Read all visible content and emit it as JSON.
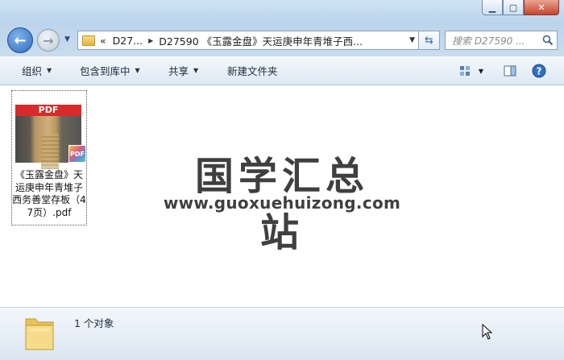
{
  "window": {
    "minimize_icon": "minimize-icon",
    "maximize_icon": "maximize-icon",
    "close_icon": "close-icon"
  },
  "address_bar": {
    "overflow": "«",
    "crumbs": [
      "D27...",
      "D27590 《玉露金盘》天运庚申年青堆子西..."
    ]
  },
  "search": {
    "placeholder": "搜索 D27590 ..."
  },
  "toolbar": {
    "organize": "组织",
    "include_library": "包含到库中",
    "share": "共享",
    "new_folder": "新建文件夹"
  },
  "file": {
    "thumb_label": "PDF",
    "badge_label": "PDF",
    "name": "《玉露金盘》天运庚申年青堆子西务善堂存板（47页）.pdf"
  },
  "watermark": {
    "title": "国学汇总站",
    "url": "www.guoxuehuizong.com"
  },
  "status": {
    "count_text": "1 个对象"
  },
  "colors": {
    "pdf_red": "#d9292a",
    "title_bar": "#b9d3ea",
    "watermark": "#3f3f3f"
  }
}
